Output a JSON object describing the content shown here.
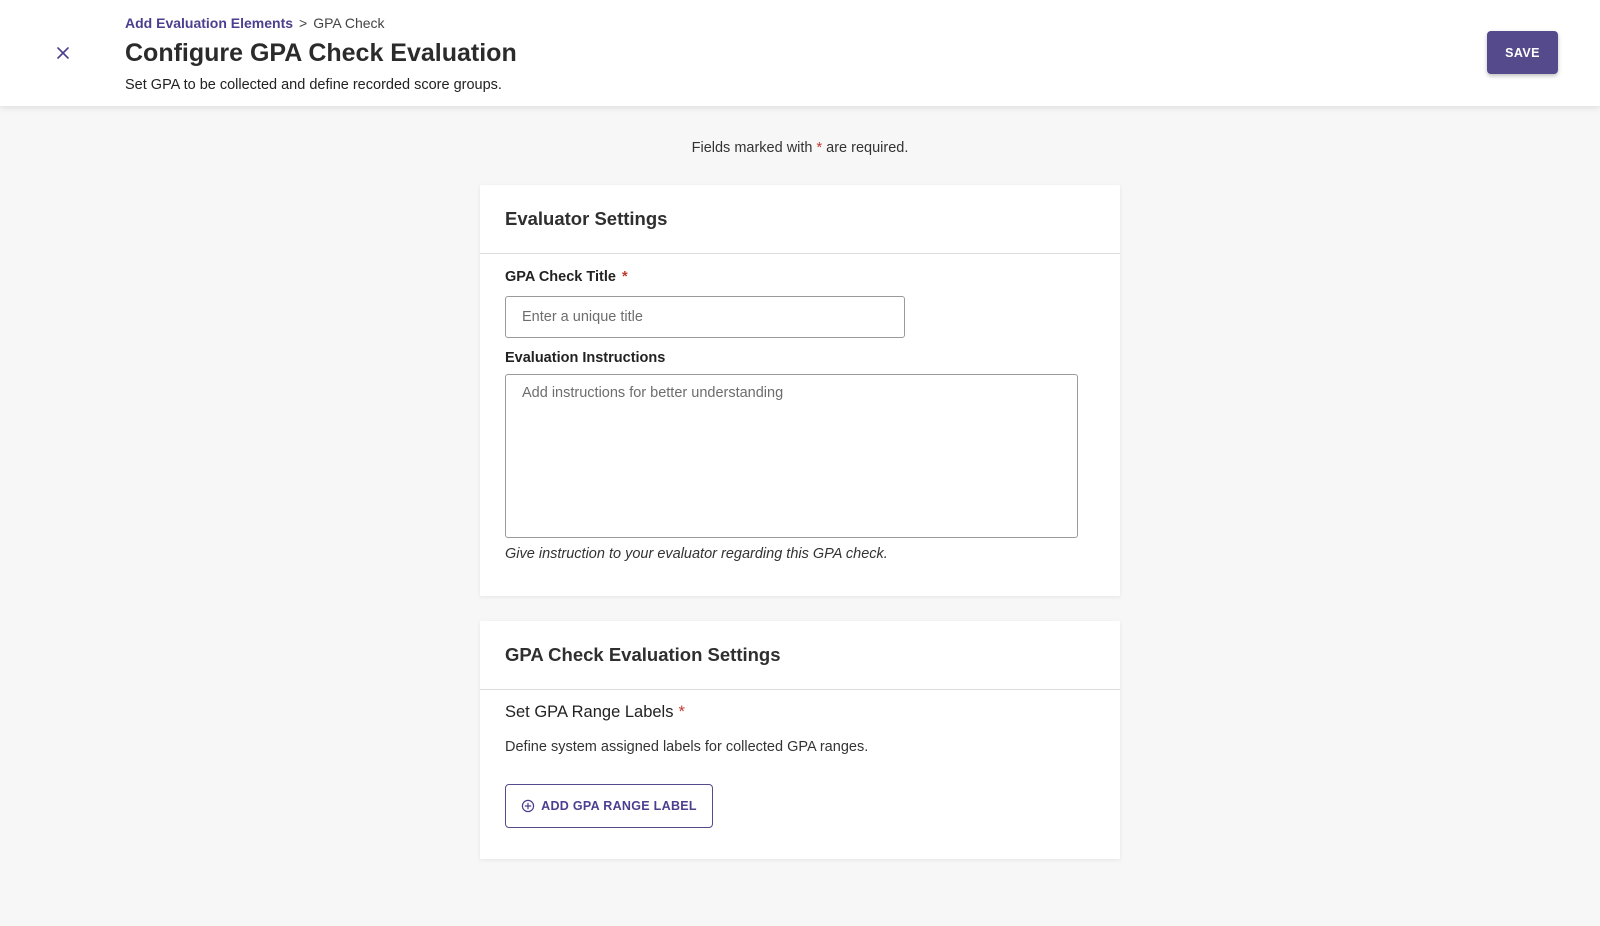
{
  "header": {
    "breadcrumb": {
      "parent": "Add Evaluation Elements",
      "separator": ">",
      "current": "GPA Check"
    },
    "title": "Configure GPA Check Evaluation",
    "subtitle": "Set GPA to be collected and define recorded score groups.",
    "save_label": "SAVE",
    "close_icon": "close-icon"
  },
  "required_note": {
    "before": "Fields marked with",
    "star": "*",
    "after": "are required."
  },
  "evaluator_settings": {
    "title": "Evaluator Settings",
    "gpa_title_label": "GPA Check Title",
    "gpa_title_star": "*",
    "gpa_title_value": "",
    "gpa_title_placeholder": "Enter a unique title",
    "instructions_label": "Evaluation Instructions",
    "instructions_value": "",
    "instructions_placeholder": "Add instructions for better understanding",
    "instructions_help": "Give instruction to your evaluator regarding this GPA check."
  },
  "gpa_settings": {
    "title": "GPA Check Evaluation Settings",
    "range_label": "Set GPA Range Labels",
    "range_star": "*",
    "range_desc": "Define system assigned labels for collected GPA ranges.",
    "add_button_label": "ADD GPA RANGE LABEL",
    "add_button_icon": "plus-circle-icon"
  },
  "colors": {
    "accent": "#544a8c",
    "link": "#4b3f8f",
    "required": "#c0392b",
    "background": "#f7f7f7"
  }
}
